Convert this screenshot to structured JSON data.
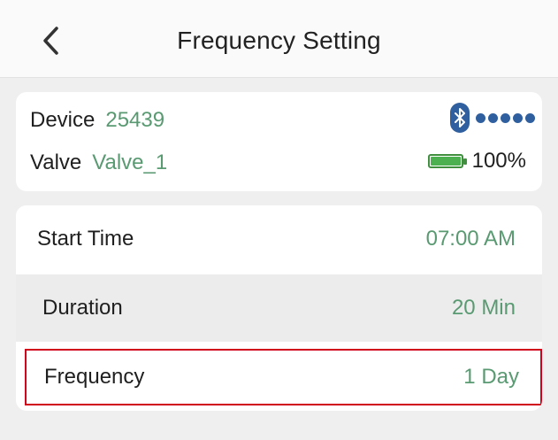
{
  "header": {
    "title": "Frequency Setting",
    "back_icon": "chevron-left-icon"
  },
  "device": {
    "device_label": "Device",
    "device_value": "25439",
    "valve_label": "Valve",
    "valve_value": "Valve_1",
    "bluetooth_icon": "bluetooth-icon",
    "signal_dots": 5,
    "battery_icon": "battery-icon",
    "battery_level": 1.0,
    "battery_text": "100%"
  },
  "settings": {
    "rows": [
      {
        "label": "Start Time",
        "value": "07:00 AM"
      },
      {
        "label": "Duration",
        "value": "20 Min"
      },
      {
        "label": "Frequency",
        "value": "1 Day"
      }
    ]
  },
  "colors": {
    "value_green": "#5a9a72",
    "highlight_red": "#d0021b",
    "bluetooth_blue": "#2f5f9e",
    "battery_green": "#4caf50"
  }
}
